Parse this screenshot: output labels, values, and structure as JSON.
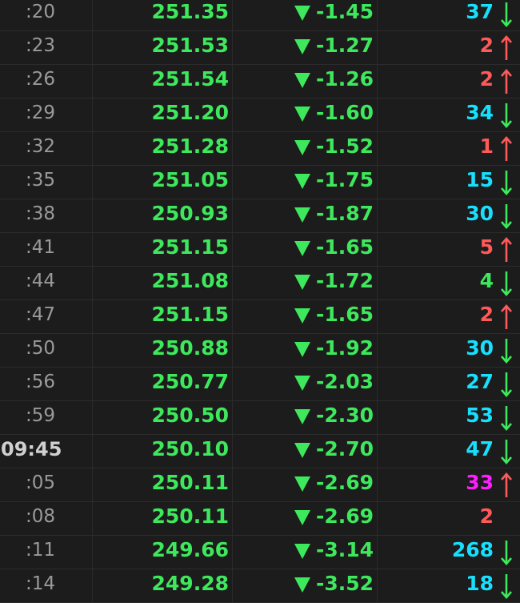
{
  "colors": {
    "background": "#1c1c1c",
    "price_green": "#3ee85c",
    "volume_cyan": "#17e0ff",
    "volume_red": "#ff5a5a",
    "volume_green": "#3ee85c",
    "volume_magenta": "#ff1eff",
    "down_triangle": "#3ee85c",
    "up_arrow": "#ff5a5a",
    "down_arrow": "#3ee85c"
  },
  "trades": [
    {
      "time": ":20",
      "price": "251.35",
      "change": "-1.45",
      "volume": "37",
      "volume_color": "cyan",
      "direction": "down",
      "change_icon": "down-triangle-icon",
      "arrow_icon": "down-arrow-icon",
      "time_major": false
    },
    {
      "time": ":23",
      "price": "251.53",
      "change": "-1.27",
      "volume": "2",
      "volume_color": "red",
      "direction": "up",
      "change_icon": "down-triangle-icon",
      "arrow_icon": "up-arrow-icon",
      "time_major": false
    },
    {
      "time": ":26",
      "price": "251.54",
      "change": "-1.26",
      "volume": "2",
      "volume_color": "red",
      "direction": "up",
      "change_icon": "down-triangle-icon",
      "arrow_icon": "up-arrow-icon",
      "time_major": false
    },
    {
      "time": ":29",
      "price": "251.20",
      "change": "-1.60",
      "volume": "34",
      "volume_color": "cyan",
      "direction": "down",
      "change_icon": "down-triangle-icon",
      "arrow_icon": "down-arrow-icon",
      "time_major": false
    },
    {
      "time": ":32",
      "price": "251.28",
      "change": "-1.52",
      "volume": "1",
      "volume_color": "red",
      "direction": "up",
      "change_icon": "down-triangle-icon",
      "arrow_icon": "up-arrow-icon",
      "time_major": false
    },
    {
      "time": ":35",
      "price": "251.05",
      "change": "-1.75",
      "volume": "15",
      "volume_color": "cyan",
      "direction": "down",
      "change_icon": "down-triangle-icon",
      "arrow_icon": "down-arrow-icon",
      "time_major": false
    },
    {
      "time": ":38",
      "price": "250.93",
      "change": "-1.87",
      "volume": "30",
      "volume_color": "cyan",
      "direction": "down",
      "change_icon": "down-triangle-icon",
      "arrow_icon": "down-arrow-icon",
      "time_major": false
    },
    {
      "time": ":41",
      "price": "251.15",
      "change": "-1.65",
      "volume": "5",
      "volume_color": "red",
      "direction": "up",
      "change_icon": "down-triangle-icon",
      "arrow_icon": "up-arrow-icon",
      "time_major": false
    },
    {
      "time": ":44",
      "price": "251.08",
      "change": "-1.72",
      "volume": "4",
      "volume_color": "green",
      "direction": "down",
      "change_icon": "down-triangle-icon",
      "arrow_icon": "down-arrow-icon",
      "time_major": false
    },
    {
      "time": ":47",
      "price": "251.15",
      "change": "-1.65",
      "volume": "2",
      "volume_color": "red",
      "direction": "up",
      "change_icon": "down-triangle-icon",
      "arrow_icon": "up-arrow-icon",
      "time_major": false
    },
    {
      "time": ":50",
      "price": "250.88",
      "change": "-1.92",
      "volume": "30",
      "volume_color": "cyan",
      "direction": "down",
      "change_icon": "down-triangle-icon",
      "arrow_icon": "down-arrow-icon",
      "time_major": false
    },
    {
      "time": ":56",
      "price": "250.77",
      "change": "-2.03",
      "volume": "27",
      "volume_color": "cyan",
      "direction": "down",
      "change_icon": "down-triangle-icon",
      "arrow_icon": "down-arrow-icon",
      "time_major": false
    },
    {
      "time": ":59",
      "price": "250.50",
      "change": "-2.30",
      "volume": "53",
      "volume_color": "cyan",
      "direction": "down",
      "change_icon": "down-triangle-icon",
      "arrow_icon": "down-arrow-icon",
      "time_major": false
    },
    {
      "time": "09:45",
      "price": "250.10",
      "change": "-2.70",
      "volume": "47",
      "volume_color": "cyan",
      "direction": "down",
      "change_icon": "down-triangle-icon",
      "arrow_icon": "down-arrow-icon",
      "time_major": true
    },
    {
      "time": ":05",
      "price": "250.11",
      "change": "-2.69",
      "volume": "33",
      "volume_color": "magenta",
      "direction": "up",
      "change_icon": "down-triangle-icon",
      "arrow_icon": "up-arrow-icon",
      "time_major": false
    },
    {
      "time": ":08",
      "price": "250.11",
      "change": "-2.69",
      "volume": "2",
      "volume_color": "red",
      "direction": "none",
      "change_icon": "down-triangle-icon",
      "arrow_icon": "",
      "time_major": false
    },
    {
      "time": ":11",
      "price": "249.66",
      "change": "-3.14",
      "volume": "268",
      "volume_color": "cyan",
      "direction": "down",
      "change_icon": "down-triangle-icon",
      "arrow_icon": "down-arrow-icon",
      "time_major": false
    },
    {
      "time": ":14",
      "price": "249.28",
      "change": "-3.52",
      "volume": "18",
      "volume_color": "cyan",
      "direction": "down",
      "change_icon": "down-triangle-icon",
      "arrow_icon": "down-arrow-icon",
      "time_major": false
    }
  ]
}
